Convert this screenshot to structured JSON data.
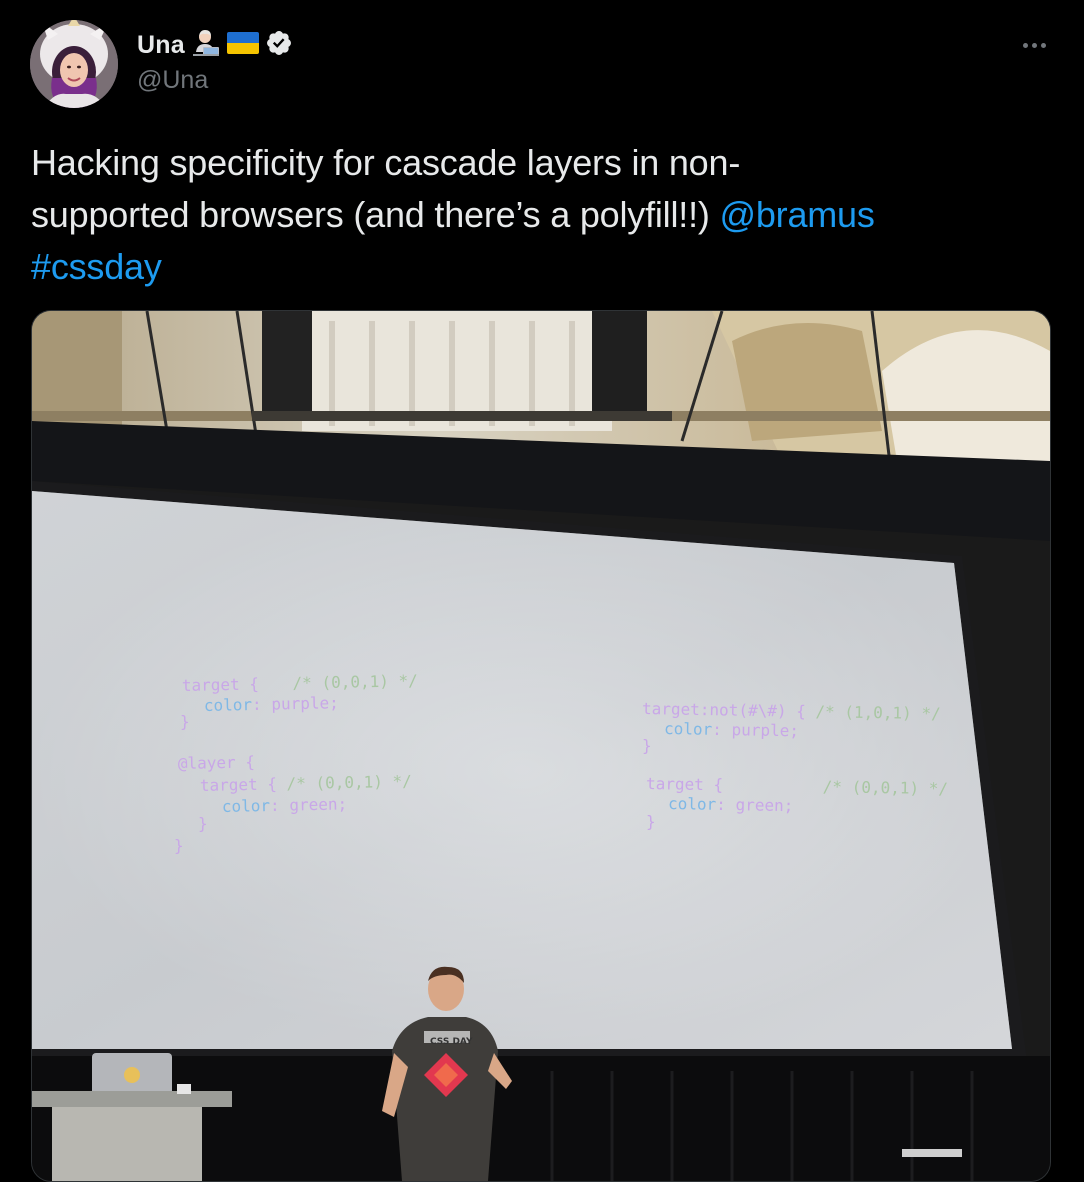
{
  "author": {
    "display_name": "Una",
    "handle": "@Una",
    "verified": true,
    "badges": [
      "woman-technologist-emoji-icon",
      "ukraine-flag-icon",
      "verified-badge-icon"
    ]
  },
  "menu": {
    "more_icon": "more-horizontal-icon"
  },
  "tweet": {
    "text_line1": "Hacking specificity for cascade layers in non-",
    "text_line2": "supported browsers (and there’s a polyfill!!) ",
    "mention": "@bramus",
    "hashtag": "#cssday"
  },
  "slide": {
    "left": {
      "l1_sel": "target {",
      "l1_comment": "/* (0,0,1) */",
      "l2_prop": "color",
      "l2_colon": ":",
      "l2_val": "purple;",
      "l3": "}",
      "l4": "@layer {",
      "l5_sel": "target {",
      "l5_comment": "/* (0,0,1) */",
      "l6_prop": "color",
      "l6_colon": ":",
      "l6_val": "green;",
      "l7": "}",
      "l8": "}"
    },
    "right": {
      "l1_sel": "target:not(#\\#) {",
      "l1_comment": "/* (1,0,1) */",
      "l2_prop": "color",
      "l2_colon": ":",
      "l2_val": "purple;",
      "l3": "}",
      "l4_sel": "target {",
      "l4_comment": "/* (0,0,1) */",
      "l5_prop": "color",
      "l5_colon": ":",
      "l5_val": "green;",
      "l6": "}"
    },
    "shirt_text": "CSS DAY"
  },
  "colors": {
    "background": "#000000",
    "text": "#e7e9ea",
    "secondary": "#71767b",
    "link": "#1d9bf0",
    "verified": "#e7e9ea",
    "code_keyword": "#c9a7e8",
    "code_property": "#7fb8e6",
    "code_comment": "#a9c7a3"
  }
}
